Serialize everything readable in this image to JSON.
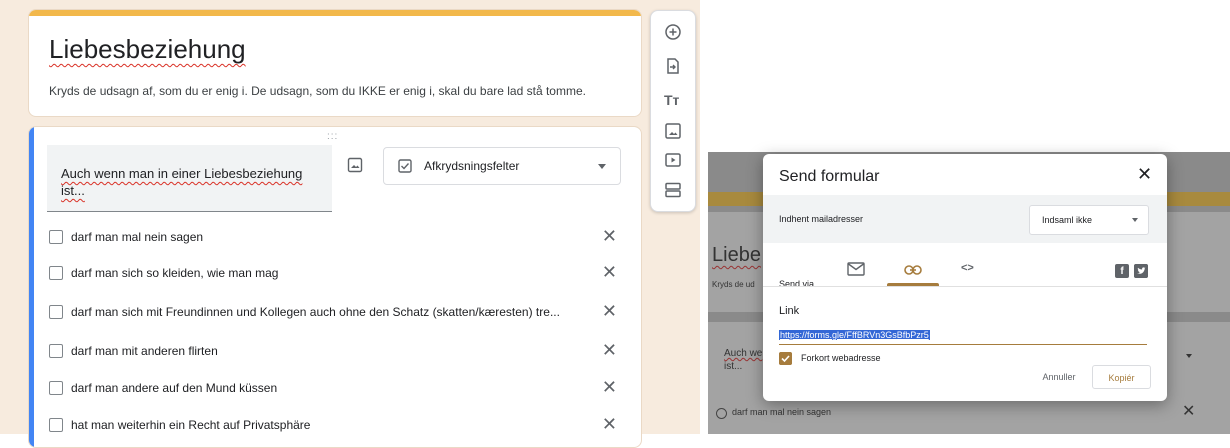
{
  "form": {
    "title": "Liebesbeziehung",
    "description": "Kryds de udsagn af, som du er enig i. De udsagn, som du IKKE er enig i, skal du bare lad stå tomme."
  },
  "question": {
    "drag_handle": ":::",
    "text": "Auch wenn man in einer Liebesbeziehung ist...",
    "type_label": "Afkrydsningsfelter",
    "options": [
      "darf man mal nein sagen",
      "darf man sich so kleiden, wie man mag",
      "darf man sich mit Freundinnen und Kollegen auch ohne den Schatz (skatten/kæresten) tre...",
      "darf man mit anderen flirten",
      "darf man andere auf den Mund küssen",
      "hat man weiterhin ein Recht auf Privatsphäre"
    ],
    "remove_glyph": "✕"
  },
  "toolbar": {
    "title_text_icon": "Tт",
    "icons": [
      "add-question-icon",
      "import-questions-icon",
      "add-title-icon",
      "add-image-icon",
      "add-video-icon",
      "add-section-icon"
    ]
  },
  "background_form": {
    "title_fragment": "Liebe",
    "desc_fragment": "Kryds de ud",
    "question_fragment_1": "Auch we",
    "question_fragment_2": "ist...",
    "option_1": "darf man mal nein sagen",
    "remove_glyph": "✕"
  },
  "dialog": {
    "title": "Send formular",
    "close_glyph": "✕",
    "email_label": "Indhent mailadresser",
    "collect_select": "Indsaml ikke",
    "send_via_label": "Send via",
    "tabs": [
      "email-tab",
      "link-tab",
      "embed-tab"
    ],
    "embed_glyph": "<>",
    "facebook_glyph": "f",
    "link_heading": "Link",
    "link_url": "https://forms.gle/FffBRVn3GsBfbPzr5",
    "shorten_label": "Forkort webadresse",
    "shorten_checked": true,
    "cancel_label": "Annuller",
    "copy_label": "Kopiér"
  },
  "colors": {
    "accent_gold": "#a67c3d",
    "question_accent": "#4285f4",
    "title_bar": "#f2b84b"
  }
}
